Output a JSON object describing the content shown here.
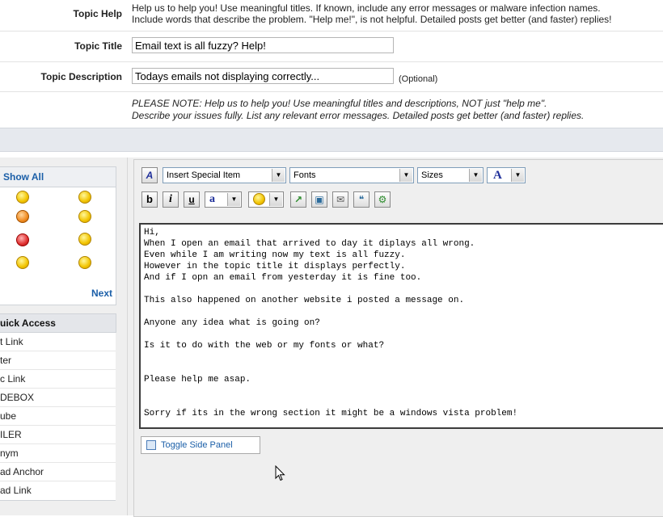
{
  "topic_help": {
    "label": "Topic Help",
    "line1": "Help us to help you! Use meaningful titles. If known, include any error messages or malware infection names.",
    "line2": "Include words that describe the problem. \"Help me!\", is not helpful. Detailed posts get better (and faster) replies!"
  },
  "topic_title": {
    "label": "Topic Title",
    "value": "Email text is all fuzzy? Help!"
  },
  "topic_description": {
    "label": "Topic Description",
    "value": "Todays emails not displaying correctly...",
    "optional": "(Optional)"
  },
  "note": {
    "line1": "PLEASE NOTE: Help us to help you! Use meaningful titles and descriptions, NOT just \"help me\".",
    "line2": "Describe your issues fully. List any relevant error messages. Detailed posts get better (and faster) replies."
  },
  "emoticons": {
    "show_all": "Show All",
    "next": "Next"
  },
  "quick_access": {
    "title": "uick Access",
    "items": [
      "t Link",
      "ter",
      "c Link",
      "DEBOX",
      "ube",
      "ILER",
      "nym",
      "ad Anchor",
      "ad Link"
    ]
  },
  "toolbar": {
    "special_item": "Insert Special Item",
    "fonts": "Fonts",
    "sizes": "Sizes",
    "bold": "b",
    "italic": "i",
    "underline": "u",
    "color_a": "A",
    "highlight_a": "a"
  },
  "editor": {
    "text": "Hi,\nWhen I open an email that arrived to day it diplays all wrong.\nEven while I am writing now my text is all fuzzy.\nHowever in the topic title it displays perfectly.\nAnd if I opn an email from yesterday it is fine too.\n\nThis also happened on another website i posted a message on.\n\nAnyone any idea what is going on?\n\nIs it to do with the web or my fonts or what?\n\n\nPlease help me asap.\n\n\nSorry if its in the wrong section it might be a windows vista problem!"
  },
  "toggle_side_panel": "Toggle Side Panel",
  "colors": {
    "link": "#1b5fa8",
    "band": "#e6e9ee"
  }
}
